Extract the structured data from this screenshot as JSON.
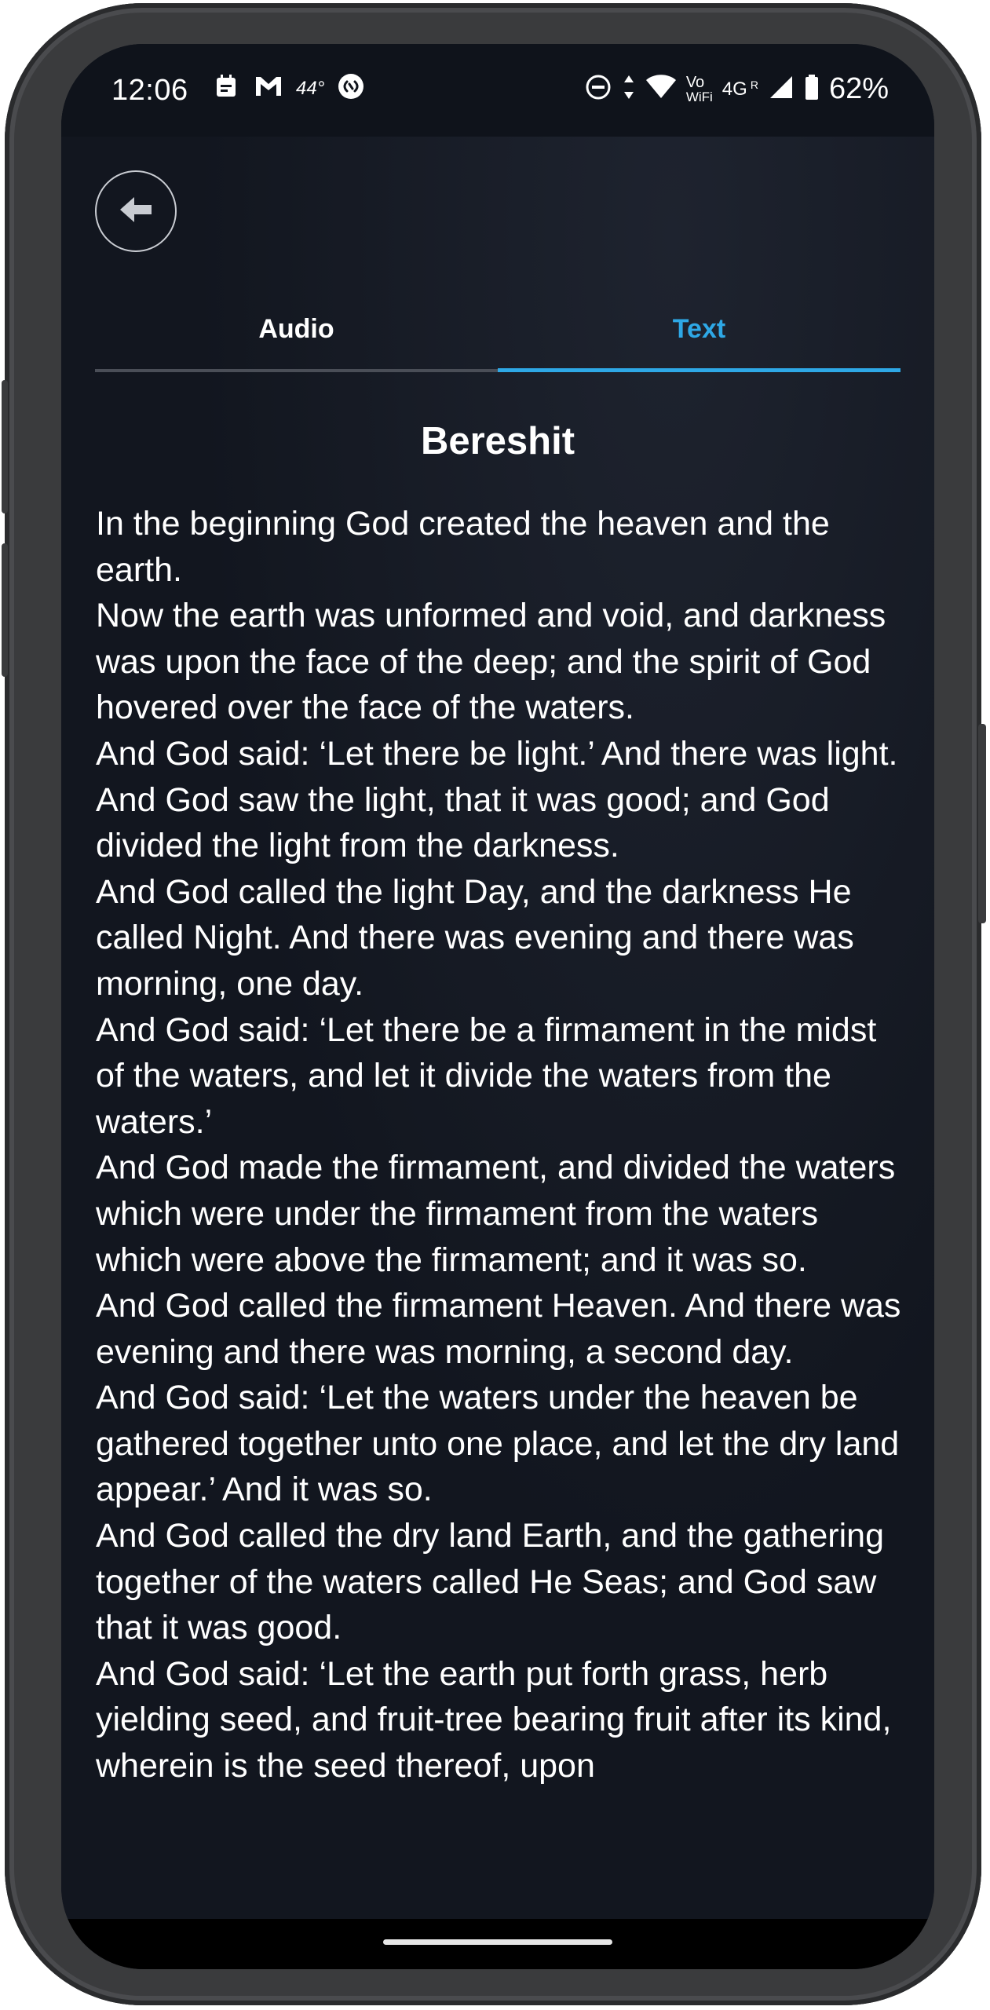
{
  "status_bar": {
    "time": "12:06",
    "temperature": "44°",
    "network_type": "4G",
    "volte_label": "Vo",
    "wifi_label": "WiFi",
    "roaming_label": "R",
    "battery": "62%"
  },
  "tabs": [
    {
      "label": "Audio",
      "active": false
    },
    {
      "label": "Text",
      "active": true
    }
  ],
  "colors": {
    "accent": "#2ea8e6",
    "background": "#12161f",
    "text": "#ffffff"
  },
  "reading": {
    "title": "Bereshit",
    "verses": [
      "In the beginning God created the heaven and the earth.",
      "Now the earth was unformed and void, and darkness was upon the face of the deep; and the spirit of God hovered over the face of the waters.",
      "And God said: ‘Let there be light.’ And there was light.",
      "And God saw the light, that it was good; and God divided the light from the darkness.",
      "And God called the light Day, and the darkness He called Night. And there was evening and there was morning, one day.",
      "And God said: ‘Let there be a firmament in the midst of the waters, and let it divide the waters from the waters.’",
      "And God made the firmament, and divided the waters which were under the firmament from the waters which were above the firmament; and it was so.",
      "And God called the firmament Heaven. And there was evening and there was morning, a second day.",
      "And God said: ‘Let the waters under the heaven be gathered together unto one place, and let the dry land appear.’ And it was so.",
      "And God called the dry land Earth, and the gathering together of the waters called He Seas; and God saw that it was good.",
      "And God said: ‘Let the earth put forth grass, herb yielding seed, and fruit-tree bearing fruit after its kind, wherein is the seed thereof, upon"
    ]
  },
  "icons": {
    "back": "arrow-left-icon",
    "status": [
      "calendar-icon",
      "gmail-icon",
      "weather-icon",
      "shazam-icon",
      "do-not-disturb-icon",
      "data-arrows-icon",
      "wifi-icon",
      "signal-icon",
      "battery-icon"
    ]
  }
}
